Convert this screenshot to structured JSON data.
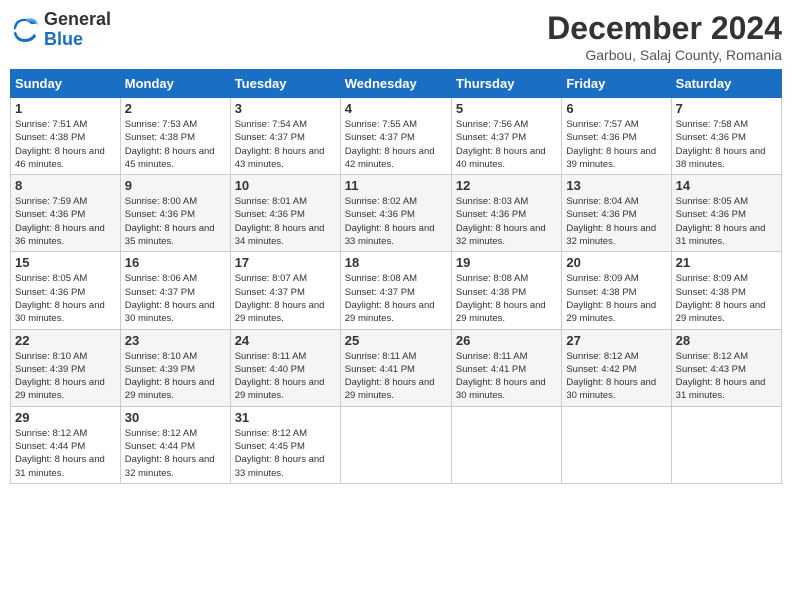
{
  "logo": {
    "general": "General",
    "blue": "Blue"
  },
  "title": "December 2024",
  "location": "Garbou, Salaj County, Romania",
  "weekdays": [
    "Sunday",
    "Monday",
    "Tuesday",
    "Wednesday",
    "Thursday",
    "Friday",
    "Saturday"
  ],
  "weeks": [
    [
      {
        "day": "1",
        "sunrise": "7:51 AM",
        "sunset": "4:38 PM",
        "daylight": "8 hours and 46 minutes."
      },
      {
        "day": "2",
        "sunrise": "7:53 AM",
        "sunset": "4:38 PM",
        "daylight": "8 hours and 45 minutes."
      },
      {
        "day": "3",
        "sunrise": "7:54 AM",
        "sunset": "4:37 PM",
        "daylight": "8 hours and 43 minutes."
      },
      {
        "day": "4",
        "sunrise": "7:55 AM",
        "sunset": "4:37 PM",
        "daylight": "8 hours and 42 minutes."
      },
      {
        "day": "5",
        "sunrise": "7:56 AM",
        "sunset": "4:37 PM",
        "daylight": "8 hours and 40 minutes."
      },
      {
        "day": "6",
        "sunrise": "7:57 AM",
        "sunset": "4:36 PM",
        "daylight": "8 hours and 39 minutes."
      },
      {
        "day": "7",
        "sunrise": "7:58 AM",
        "sunset": "4:36 PM",
        "daylight": "8 hours and 38 minutes."
      }
    ],
    [
      {
        "day": "8",
        "sunrise": "7:59 AM",
        "sunset": "4:36 PM",
        "daylight": "8 hours and 36 minutes."
      },
      {
        "day": "9",
        "sunrise": "8:00 AM",
        "sunset": "4:36 PM",
        "daylight": "8 hours and 35 minutes."
      },
      {
        "day": "10",
        "sunrise": "8:01 AM",
        "sunset": "4:36 PM",
        "daylight": "8 hours and 34 minutes."
      },
      {
        "day": "11",
        "sunrise": "8:02 AM",
        "sunset": "4:36 PM",
        "daylight": "8 hours and 33 minutes."
      },
      {
        "day": "12",
        "sunrise": "8:03 AM",
        "sunset": "4:36 PM",
        "daylight": "8 hours and 32 minutes."
      },
      {
        "day": "13",
        "sunrise": "8:04 AM",
        "sunset": "4:36 PM",
        "daylight": "8 hours and 32 minutes."
      },
      {
        "day": "14",
        "sunrise": "8:05 AM",
        "sunset": "4:36 PM",
        "daylight": "8 hours and 31 minutes."
      }
    ],
    [
      {
        "day": "15",
        "sunrise": "8:05 AM",
        "sunset": "4:36 PM",
        "daylight": "8 hours and 30 minutes."
      },
      {
        "day": "16",
        "sunrise": "8:06 AM",
        "sunset": "4:37 PM",
        "daylight": "8 hours and 30 minutes."
      },
      {
        "day": "17",
        "sunrise": "8:07 AM",
        "sunset": "4:37 PM",
        "daylight": "8 hours and 29 minutes."
      },
      {
        "day": "18",
        "sunrise": "8:08 AM",
        "sunset": "4:37 PM",
        "daylight": "8 hours and 29 minutes."
      },
      {
        "day": "19",
        "sunrise": "8:08 AM",
        "sunset": "4:38 PM",
        "daylight": "8 hours and 29 minutes."
      },
      {
        "day": "20",
        "sunrise": "8:09 AM",
        "sunset": "4:38 PM",
        "daylight": "8 hours and 29 minutes."
      },
      {
        "day": "21",
        "sunrise": "8:09 AM",
        "sunset": "4:38 PM",
        "daylight": "8 hours and 29 minutes."
      }
    ],
    [
      {
        "day": "22",
        "sunrise": "8:10 AM",
        "sunset": "4:39 PM",
        "daylight": "8 hours and 29 minutes."
      },
      {
        "day": "23",
        "sunrise": "8:10 AM",
        "sunset": "4:39 PM",
        "daylight": "8 hours and 29 minutes."
      },
      {
        "day": "24",
        "sunrise": "8:11 AM",
        "sunset": "4:40 PM",
        "daylight": "8 hours and 29 minutes."
      },
      {
        "day": "25",
        "sunrise": "8:11 AM",
        "sunset": "4:41 PM",
        "daylight": "8 hours and 29 minutes."
      },
      {
        "day": "26",
        "sunrise": "8:11 AM",
        "sunset": "4:41 PM",
        "daylight": "8 hours and 30 minutes."
      },
      {
        "day": "27",
        "sunrise": "8:12 AM",
        "sunset": "4:42 PM",
        "daylight": "8 hours and 30 minutes."
      },
      {
        "day": "28",
        "sunrise": "8:12 AM",
        "sunset": "4:43 PM",
        "daylight": "8 hours and 31 minutes."
      }
    ],
    [
      {
        "day": "29",
        "sunrise": "8:12 AM",
        "sunset": "4:44 PM",
        "daylight": "8 hours and 31 minutes."
      },
      {
        "day": "30",
        "sunrise": "8:12 AM",
        "sunset": "4:44 PM",
        "daylight": "8 hours and 32 minutes."
      },
      {
        "day": "31",
        "sunrise": "8:12 AM",
        "sunset": "4:45 PM",
        "daylight": "8 hours and 33 minutes."
      },
      null,
      null,
      null,
      null
    ]
  ]
}
